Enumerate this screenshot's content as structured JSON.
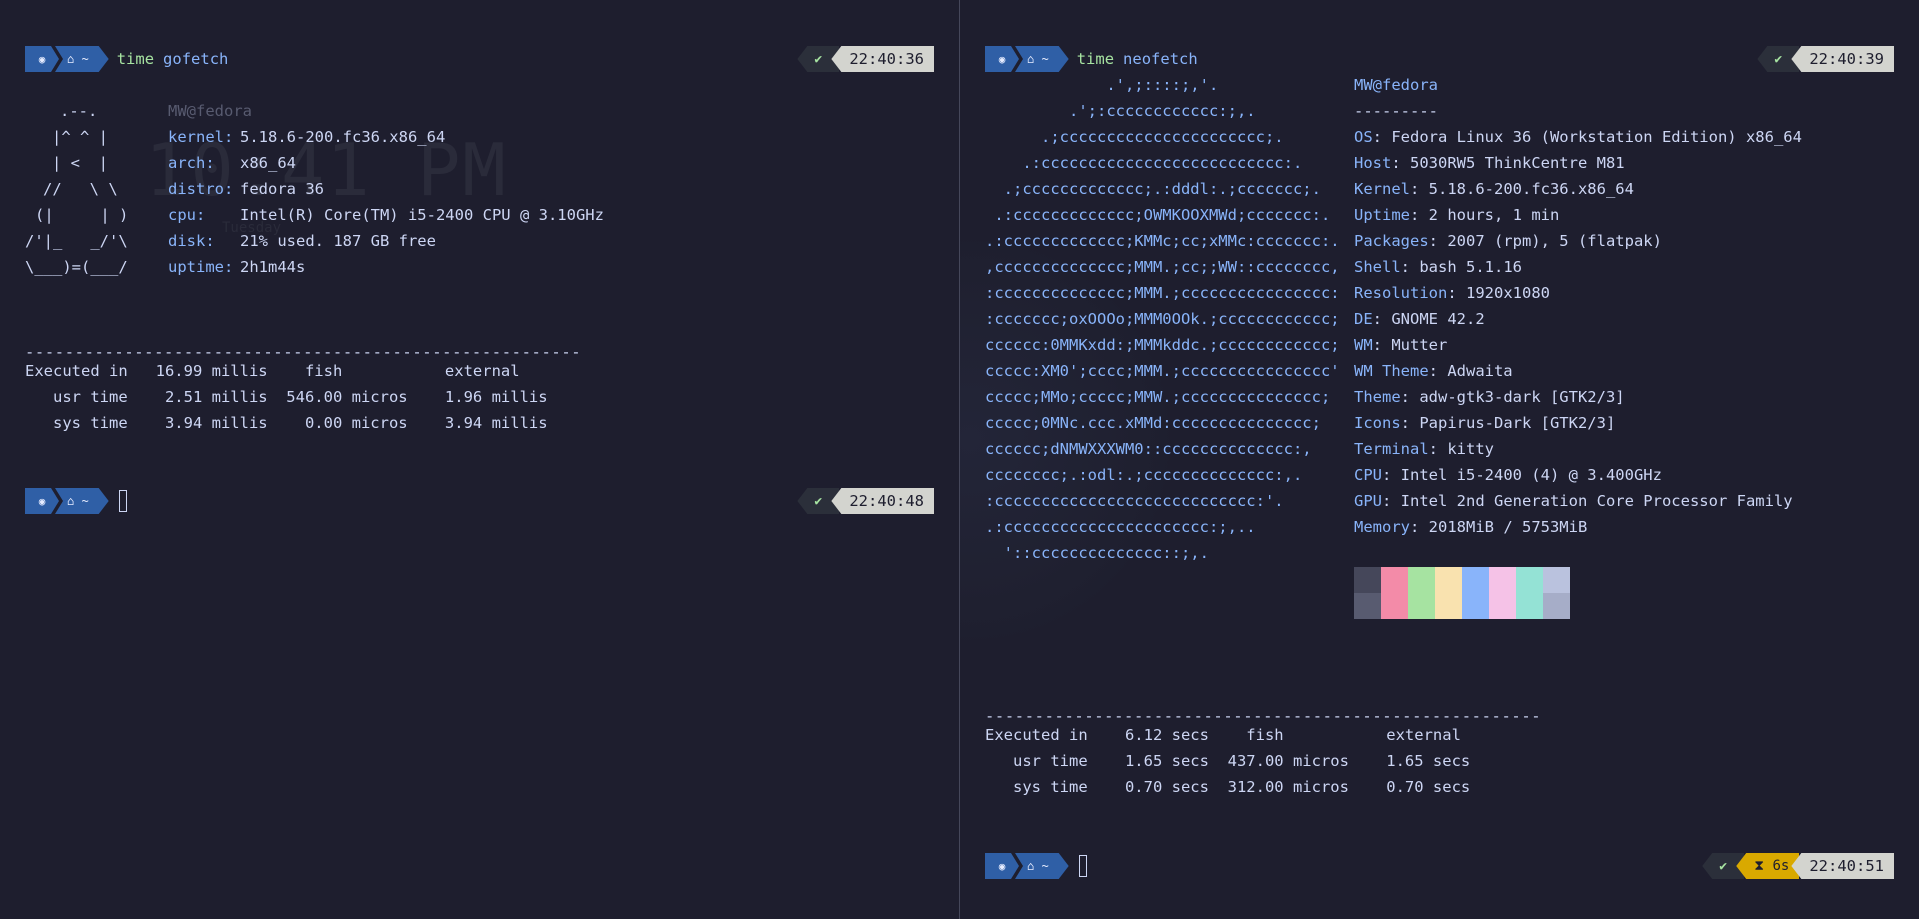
{
  "colors": {
    "bg": "#1e1e2e",
    "key_blue": "#89b4fa",
    "prompt_blue": "#2f5fa6",
    "duration_yellow": "#d9a900"
  },
  "left": {
    "prompt1": {
      "os_icon": "fedora-icon",
      "home_icon": "home-icon",
      "dir": "~",
      "cmd_word": "time",
      "cmd_arg": "gofetch",
      "status": "✔",
      "time": "22:40:36"
    },
    "background_clock": {
      "time": "10:41 PM",
      "sub": "Tuesday"
    },
    "ascii": [
      ".--.",
      "|^ ^ |",
      "| <  |",
      "//   \\ \\",
      "(|     | )",
      "/'|_   _/'\\",
      "\\___)=(___/"
    ],
    "user_host": "MW@fedora",
    "info": [
      {
        "key": "kernel:",
        "value": "5.18.6-200.fc36.x86_64"
      },
      {
        "key": "arch:",
        "value": "x86_64"
      },
      {
        "key": "distro:",
        "value": "fedora 36"
      },
      {
        "key": "cpu:",
        "value": "Intel(R) Core(TM) i5-2400 CPU @ 3.10GHz"
      },
      {
        "key": "disk:",
        "value": "21% used. 187 GB free"
      },
      {
        "key": "uptime:",
        "value": "2h1m44s"
      }
    ],
    "separator": "--------------------------------------------------------",
    "timing": [
      "Executed in   16.99 millis    fish           external",
      "   usr time    2.51 millis  546.00 micros    1.96 millis",
      "   sys time    3.94 millis    0.00 micros    3.94 millis"
    ],
    "prompt2": {
      "dir": "~",
      "status": "✔",
      "time": "22:40:48"
    }
  },
  "right": {
    "prompt1": {
      "dir": "~",
      "cmd_word": "time",
      "cmd_arg": "neofetch",
      "status": "✔",
      "time": "22:40:39"
    },
    "ascii": [
      "             .',;::::;,'.",
      "         .';:cccccccccccc:;,.",
      "      .;cccccccccccccccccccccc;.",
      "    .:cccccccccccccccccccccccccc:.",
      "  .;ccccccccccccc;.:dddl:.;ccccccc;.",
      " .:ccccccccccccc;OWMKOOXMWd;ccccccc:.",
      ".:ccccccccccccc;KMMc;cc;xMMc:ccccccc:.",
      ",cccccccccccccc;MMM.;cc;;WW::cccccccc,",
      ":cccccccccccccc;MMM.;cccccccccccccccc:",
      ":ccccccc;oxOOOo;MMM0OOk.;cccccccccccc;",
      "cccccc:0MMKxdd:;MMMkddc.;cccccccccccc;",
      "ccccc:XM0';cccc;MMM.;cccccccccccccccc'",
      "ccccc;MMo;ccccc;MMW.;ccccccccccccccc;",
      "ccccc;0MNc.ccc.xMMd:ccccccccccccccc;",
      "cccccc;dNMWXXXWM0::cccccccccccccc:,",
      "cccccccc;.:odl:.;cccccccccccccc:,.",
      ":cccccccccccccccccccccccccccc:'.",
      ".:cccccccccccccccccccccc:;,..",
      "  '::cccccccccccccc::;,."
    ],
    "user_host": "MW@fedora",
    "underline": "---------",
    "info": [
      {
        "key": "OS",
        "value": ": Fedora Linux 36 (Workstation Edition) x86_64"
      },
      {
        "key": "Host",
        "value": ": 5030RW5 ThinkCentre M81"
      },
      {
        "key": "Kernel",
        "value": ": 5.18.6-200.fc36.x86_64"
      },
      {
        "key": "Uptime",
        "value": ": 2 hours, 1 min"
      },
      {
        "key": "Packages",
        "value": ": 2007 (rpm), 5 (flatpak)"
      },
      {
        "key": "Shell",
        "value": ": bash 5.1.16"
      },
      {
        "key": "Resolution",
        "value": ": 1920x1080"
      },
      {
        "key": "DE",
        "value": ": GNOME 42.2"
      },
      {
        "key": "WM",
        "value": ": Mutter"
      },
      {
        "key": "WM Theme",
        "value": ": Adwaita"
      },
      {
        "key": "Theme",
        "value": ": adw-gtk3-dark [GTK2/3]"
      },
      {
        "key": "Icons",
        "value": ": Papirus-Dark [GTK2/3]"
      },
      {
        "key": "Terminal",
        "value": ": kitty"
      },
      {
        "key": "CPU",
        "value": ": Intel i5-2400 (4) @ 3.400GHz"
      },
      {
        "key": "GPU",
        "value": ": Intel 2nd Generation Core Processor Family"
      },
      {
        "key": "Memory",
        "value": ": 2018MiB / 5753MiB"
      }
    ],
    "swatches_top": [
      "#45475a",
      "#f38ba8",
      "#a6e3a1",
      "#f9e2af",
      "#89b4fa",
      "#f5c2e7",
      "#94e2d5",
      "#bac2de"
    ],
    "swatches_bottom": [
      "#585b70",
      "#f38ba8",
      "#a6e3a1",
      "#f9e2af",
      "#89b4fa",
      "#f5c2e7",
      "#94e2d5",
      "#a6adc8"
    ],
    "separator": "--------------------------------------------------------",
    "timing": [
      "Executed in    6.12 secs    fish           external",
      "   usr time    1.65 secs  437.00 micros    1.65 secs",
      "   sys time    0.70 secs  312.00 micros    0.70 secs"
    ],
    "prompt2": {
      "dir": "~",
      "status": "✔",
      "duration": "⧗ 6s",
      "time": "22:40:51"
    }
  }
}
